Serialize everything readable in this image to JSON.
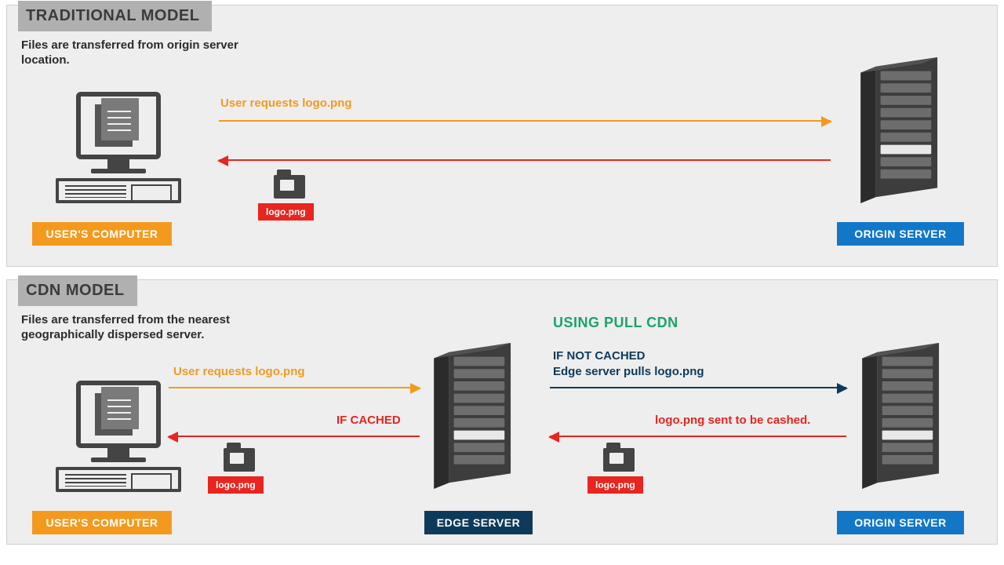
{
  "top": {
    "title": "TRADITIONAL MODEL",
    "desc": "Files are transferred from origin server location.",
    "request_label": "User requests logo.png",
    "file_name": "logo.png",
    "user_label": "USER'S COMPUTER",
    "origin_label": "ORIGIN SERVER"
  },
  "bot": {
    "title": "CDN MODEL",
    "desc": "Files are transferred from the nearest geographically dispersed server.",
    "pull_title": "USING PULL CDN",
    "request_label": "User requests logo.png",
    "if_cached": "IF CACHED",
    "if_not_cached": "IF NOT CACHED",
    "pull_label": "Edge server pulls logo.png",
    "sent_label": "logo.png sent to be cashed.",
    "file_name_left": "logo.png",
    "file_name_right": "logo.png",
    "user_label": "USER'S COMPUTER",
    "edge_label": "EDGE SERVER",
    "origin_label": "ORIGIN SERVER"
  }
}
